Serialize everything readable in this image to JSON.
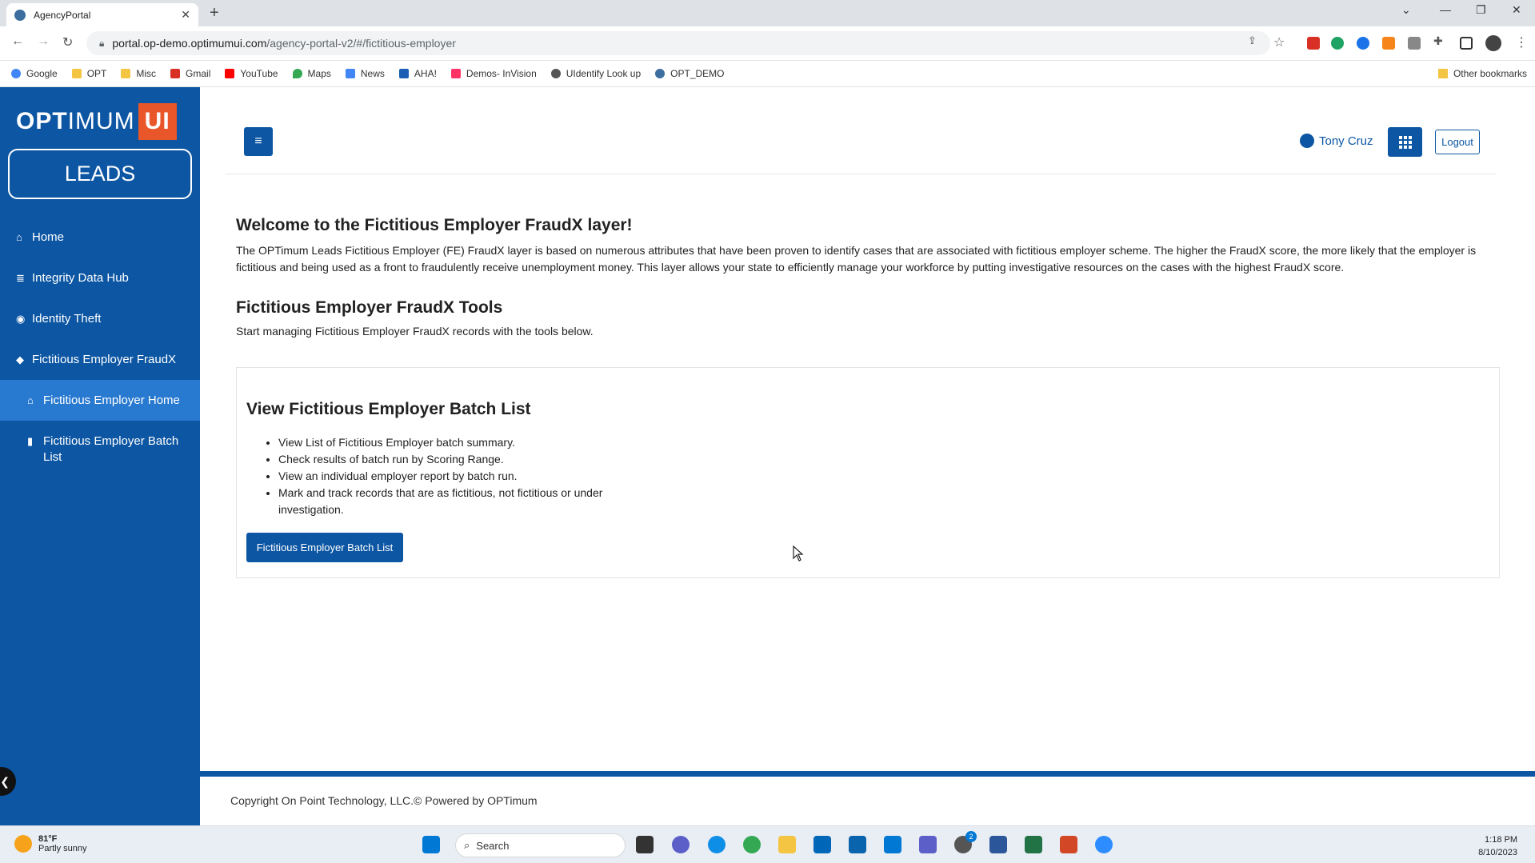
{
  "browser": {
    "tab_title": "AgencyPortal",
    "tab_close": "✕",
    "new_tab": "+",
    "url_host": "portal.op-demo.optimumui.com",
    "url_path": "/agency-portal-v2/#/fictitious-employer",
    "bookmarks": [
      {
        "label": "Google",
        "color": "#4285f4"
      },
      {
        "label": "OPT",
        "color": "#f4c542"
      },
      {
        "label": "Misc",
        "color": "#f4c542"
      },
      {
        "label": "Gmail",
        "color": "#d93025"
      },
      {
        "label": "YouTube",
        "color": "#ff0000"
      },
      {
        "label": "Maps",
        "color": "#34a853"
      },
      {
        "label": "News",
        "color": "#4285f4"
      },
      {
        "label": "AHA!",
        "color": "#1a5fb4"
      },
      {
        "label": "Demos- InVision",
        "color": "#ff3366"
      },
      {
        "label": "UIdentify Look up",
        "color": "#555555"
      },
      {
        "label": "OPT_DEMO",
        "color": "#3c6e9f"
      }
    ],
    "other_bookmarks": "Other bookmarks"
  },
  "sidebar": {
    "logo_opt": "OPT",
    "logo_imum": "IMUM",
    "logo_ui": "UI",
    "section_title": "LEADS",
    "items": [
      {
        "label": "Home",
        "icon": "home-icon",
        "glyph": "⌂"
      },
      {
        "label": "Integrity Data Hub",
        "icon": "database-icon",
        "glyph": "≣"
      },
      {
        "label": "Identity Theft",
        "icon": "eye-icon",
        "glyph": "◉"
      },
      {
        "label": "Fictitious Employer FraudX",
        "icon": "tags-icon",
        "glyph": "◆"
      },
      {
        "label": "Fictitious Employer Home",
        "icon": "home-icon",
        "glyph": "⌂"
      },
      {
        "label": "Fictitious Employer Batch List",
        "icon": "clipboard-icon",
        "glyph": "▮"
      }
    ],
    "collapse_glyph": "❮"
  },
  "header": {
    "menu_glyph": "≡",
    "user_name": "Tony Cruz",
    "logout_label": "Logout"
  },
  "main": {
    "welcome_title": "Welcome to the Fictitious Employer FraudX layer!",
    "description": "The OPTimum Leads Fictitious Employer (FE) FraudX layer is based on numerous attributes that have been proven to identify cases that are associated with fictitious employer scheme. The higher the FraudX score, the more likely that the employer is fictitious and being used as a front to fraudulently receive unemployment money. This layer allows your state to efficiently manage your workforce by putting investigative resources on the cases with the highest FraudX score.",
    "tools_title": "Fictitious Employer FraudX Tools",
    "tools_subtitle": "Start managing Fictitious Employer FraudX records with the tools below.",
    "card": {
      "title": "View Fictitious Employer Batch List",
      "bullets": [
        "View List of Fictitious Employer batch summary.",
        "Check results of batch run by Scoring Range.",
        "View an individual employer report by batch run.",
        "Mark and track records that are as fictitious, not fictitious or under investigation."
      ],
      "button_label": "Fictitious Employer Batch List"
    }
  },
  "footer": {
    "copyright": "Copyright On Point Technology, LLC.© Powered by OPTimum"
  },
  "taskbar": {
    "temperature": "81°F",
    "weather": "Partly sunny",
    "search_label": "Search",
    "time": "1:18 PM",
    "date": "8/10/2023",
    "badge_count": "2"
  },
  "colors": {
    "brand_blue": "#0c56a3",
    "active_blue": "#2879d0",
    "logo_orange": "#e8562a"
  }
}
